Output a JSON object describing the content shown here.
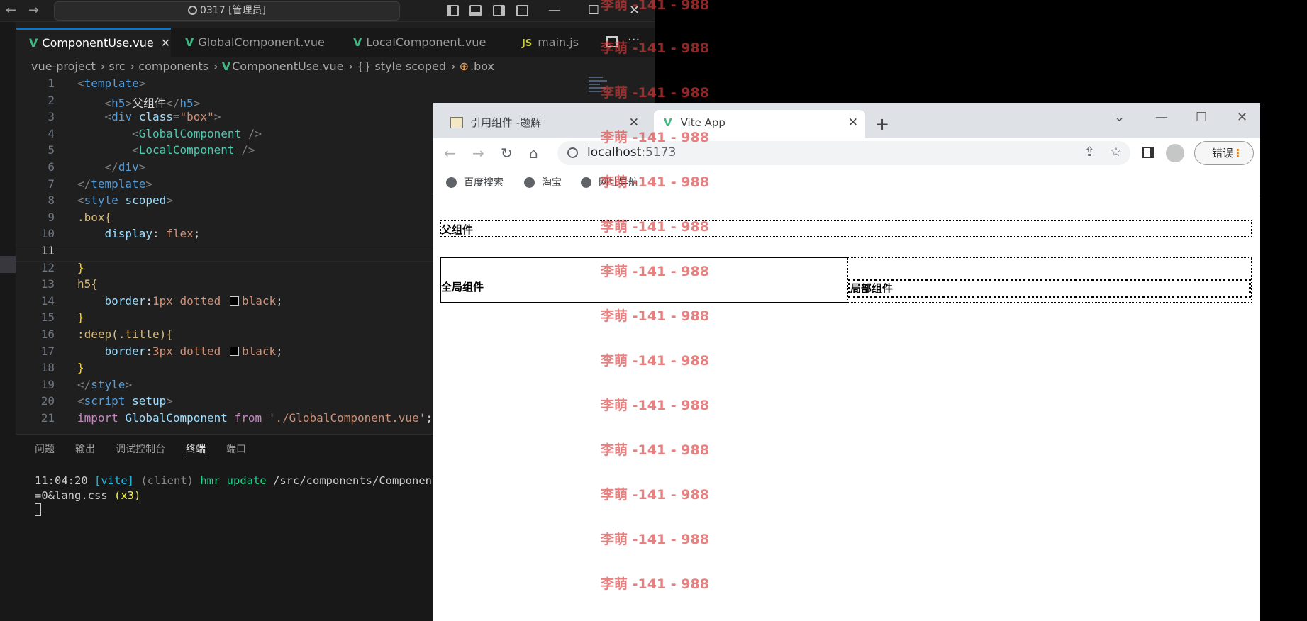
{
  "titlebar": {
    "back": "←",
    "forward": "→",
    "command_center": "0317 [管理员]",
    "minimize": "—",
    "maximize": "☐",
    "close": "✕"
  },
  "editor_tabs": [
    {
      "label": "ComponentUse.vue",
      "icon": "vue-icon",
      "active": true
    },
    {
      "label": "GlobalComponent.vue",
      "icon": "vue-icon"
    },
    {
      "label": "LocalComponent.vue",
      "icon": "vue-icon"
    },
    {
      "label": "main.js",
      "icon": "js-icon",
      "icon_text": "JS"
    }
  ],
  "tab_more": "···",
  "breadcrumb": [
    "vue-project",
    "src",
    "components",
    "ComponentUse.vue",
    "{} style scoped",
    ".box"
  ],
  "line_numbers": [
    "1",
    "2",
    "3",
    "4",
    "5",
    "6",
    "7",
    "8",
    "9",
    "10",
    "11",
    "12",
    "13",
    "14",
    "15",
    "16",
    "17",
    "18",
    "19",
    "20",
    "21"
  ],
  "code": {
    "l2_text": "父组件",
    "class_value": "\"box\"",
    "comp_global": "GlobalComponent",
    "comp_local": "LocalComponent",
    "box_selector": ".box{",
    "display_prop": "display",
    "display_val": "flex",
    "h5_sel": "h5{",
    "border_prop": "border",
    "border1_val": "1px dotted",
    "black": "black",
    "deep_sel": ":deep(.title){",
    "border3_val": "3px dotted",
    "import_kw": "import",
    "from_kw": "from",
    "import_path": "'./GlobalComponent.vue'"
  },
  "panel": {
    "tabs": [
      "问题",
      "输出",
      "调试控制台",
      "终端",
      "端口"
    ],
    "active_tab": "终端",
    "term_time": "11:04:20",
    "term_vite": "[vite]",
    "term_client": "(client)",
    "term_hmr": "hmr update",
    "term_path": "/src/components/ComponentUs",
    "term_line2": "=0&lang.css",
    "term_count": "(x3)"
  },
  "browser": {
    "tabs": [
      {
        "label": "引用组件 -题解",
        "active": false
      },
      {
        "label": "Vite App",
        "active": true
      }
    ],
    "new_tab": "+",
    "url_host": "localhost",
    "url_port": ":5173",
    "error_button": "错误",
    "error_dots": "⋮",
    "bookmarks": [
      "百度搜索",
      "淘宝",
      "网址导航"
    ]
  },
  "page": {
    "parent_heading": "父组件",
    "global_component": "全局组件",
    "local_component": "局部组件"
  },
  "watermark": "李萌 -141 - 988",
  "colors": {
    "vscode_bg": "#1f1f1f",
    "accent": "#0078d4",
    "vue_green": "#41b883",
    "watermark": "#dc3c3c"
  }
}
